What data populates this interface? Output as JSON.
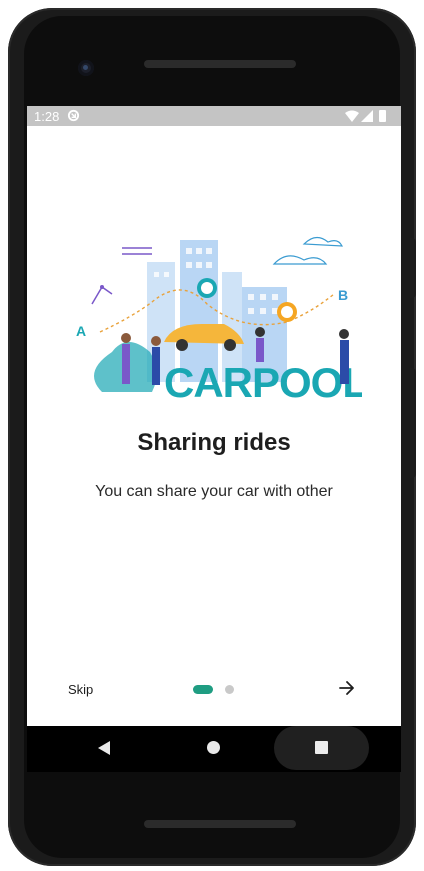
{
  "statusbar": {
    "time": "1:28"
  },
  "onboarding": {
    "illustration": {
      "wordmark": "CARPOOL",
      "point_a": "A",
      "point_b": "B"
    },
    "title": "Sharing rides",
    "subtitle": "You can share your car with other",
    "skip_label": "Skip",
    "page_count": 2,
    "current_page": 1
  },
  "icons": {
    "sync": "sync-icon",
    "wifi": "wifi-icon",
    "signal": "signal-icon",
    "battery": "battery-icon",
    "next": "arrow-right-icon",
    "back": "back-triangle-icon",
    "home": "home-circle-icon",
    "recents": "recents-square-icon"
  },
  "colors": {
    "accent": "#1f9d82",
    "dot_inactive": "#c9c9c9",
    "statusbar": "#c4c4c4",
    "wordmark": "#1aa7b3",
    "car": "#f5b63b"
  }
}
